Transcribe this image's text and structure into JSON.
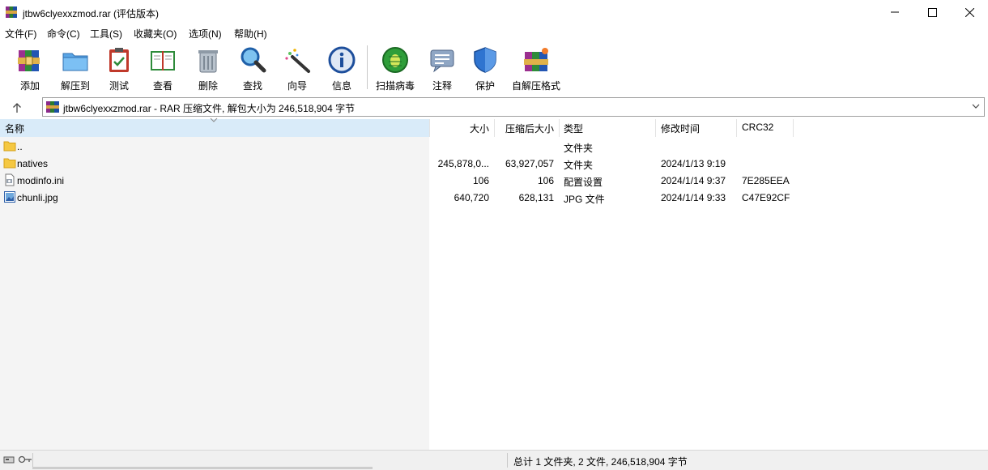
{
  "window": {
    "title": "jtbw6clyexxzmod.rar (评估版本)",
    "controls": {
      "minimize": "minimize",
      "maximize": "maximize",
      "close": "close"
    }
  },
  "menu": {
    "items": [
      "文件(F)",
      "命令(C)",
      "工具(S)",
      "收藏夹(O)",
      "选项(N)",
      "帮助(H)"
    ]
  },
  "toolbar": {
    "buttons": [
      {
        "label": "添加",
        "icon": "add-archive-icon"
      },
      {
        "label": "解压到",
        "icon": "extract-folder-icon"
      },
      {
        "label": "测试",
        "icon": "test-clipboard-icon"
      },
      {
        "label": "查看",
        "icon": "view-book-icon"
      },
      {
        "label": "删除",
        "icon": "trash-can-icon"
      },
      {
        "label": "查找",
        "icon": "magnifier-icon"
      },
      {
        "label": "向导",
        "icon": "magic-wand-icon"
      },
      {
        "label": "信息",
        "icon": "info-icon"
      },
      {
        "label": "扫描病毒",
        "icon": "virus-scan-icon"
      },
      {
        "label": "注释",
        "icon": "comment-icon"
      },
      {
        "label": "保护",
        "icon": "shield-icon"
      },
      {
        "label": "自解压格式",
        "icon": "sfx-archive-icon"
      }
    ]
  },
  "address": {
    "text": "jtbw6clyexxzmod.rar - RAR 压缩文件, 解包大小为 246,518,904 字节"
  },
  "columns": {
    "name": "名称",
    "size": "大小",
    "packed": "压缩后大小",
    "type": "类型",
    "modified": "修改时间",
    "crc": "CRC32"
  },
  "files": [
    {
      "name": "..",
      "size": "",
      "packed": "",
      "type": "文件夹",
      "modified": "",
      "crc": "",
      "icon": "folder-up-icon"
    },
    {
      "name": "natives",
      "size": "245,878,0...",
      "packed": "63,927,057",
      "type": "文件夹",
      "modified": "2024/1/13 9:19",
      "crc": "",
      "icon": "folder-icon"
    },
    {
      "name": "modinfo.ini",
      "size": "106",
      "packed": "106",
      "type": "配置设置",
      "modified": "2024/1/14 9:37",
      "crc": "7E285EEA",
      "icon": "ini-file-icon"
    },
    {
      "name": "chunli.jpg",
      "size": "640,720",
      "packed": "628,131",
      "type": "JPG 文件",
      "modified": "2024/1/14 9:33",
      "crc": "C47E92CF",
      "icon": "image-file-icon"
    }
  ],
  "status": {
    "summary": "总计 1 文件夹, 2 文件, 246,518,904 字节"
  }
}
